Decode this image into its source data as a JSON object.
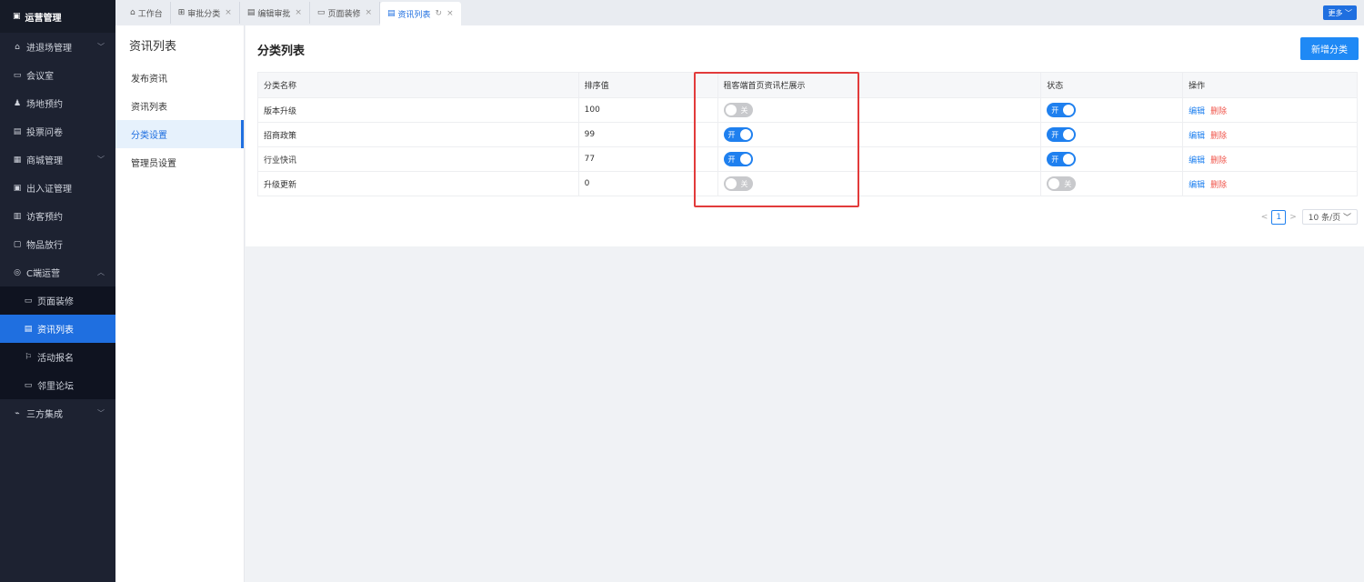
{
  "sidebar": {
    "header": "运营管理",
    "items": [
      {
        "label": "进退场管理",
        "icon": "home-icon",
        "chev": "﹀"
      },
      {
        "label": "会议室",
        "icon": "monitor-icon",
        "chev": ""
      },
      {
        "label": "场地预约",
        "icon": "user-icon",
        "chev": ""
      },
      {
        "label": "投票问卷",
        "icon": "document-icon",
        "chev": ""
      },
      {
        "label": "商城管理",
        "icon": "shop-icon",
        "chev": "﹀"
      },
      {
        "label": "出入证管理",
        "icon": "card-icon",
        "chev": ""
      },
      {
        "label": "访客预约",
        "icon": "visitor-icon",
        "chev": ""
      },
      {
        "label": "物品放行",
        "icon": "box-icon",
        "chev": ""
      },
      {
        "label": "C端运营",
        "icon": "c-icon",
        "chev": "︿"
      }
    ],
    "sub_items": [
      {
        "label": "页面装修",
        "icon": "page-icon"
      },
      {
        "label": "资讯列表",
        "icon": "news-icon"
      },
      {
        "label": "活动报名",
        "icon": "flag-icon"
      },
      {
        "label": "邻里论坛",
        "icon": "chat-icon"
      }
    ],
    "tail": {
      "label": "三方集成",
      "icon": "link-icon",
      "chev": "﹀"
    }
  },
  "tabs": [
    {
      "label": "工作台",
      "icon": "home-icon",
      "closable": false
    },
    {
      "label": "审批分类",
      "icon": "grid-icon",
      "closable": true
    },
    {
      "label": "编辑审批",
      "icon": "edit-icon",
      "closable": true
    },
    {
      "label": "页面装修",
      "icon": "page-icon",
      "closable": true
    },
    {
      "label": "资讯列表",
      "icon": "news-icon",
      "closable": true,
      "active": true
    }
  ],
  "more_label": "更多 ﹀",
  "submenu": {
    "title": "资讯列表",
    "items": [
      "发布资讯",
      "资讯列表",
      "分类设置",
      "管理员设置"
    ],
    "active_index": 2
  },
  "main": {
    "title": "分类列表",
    "add_button": "新增分类",
    "columns": [
      "分类名称",
      "排序值",
      "租客端首页资讯栏展示",
      "状态",
      "操作"
    ],
    "rows": [
      {
        "name": "版本升级",
        "sort": "100",
        "show_home": false,
        "status": true
      },
      {
        "name": "招商政策",
        "sort": "99",
        "show_home": true,
        "status": true
      },
      {
        "name": "行业快讯",
        "sort": "77",
        "show_home": true,
        "status": true
      },
      {
        "name": "升级更新",
        "sort": "0",
        "show_home": false,
        "status": false
      }
    ],
    "switch_on_label": "开",
    "switch_off_label": "关",
    "action_edit": "编辑",
    "action_delete": "删除",
    "pager": {
      "prev": "<",
      "page": "1",
      "next": ">",
      "size": "10 条/页 ﹀"
    }
  },
  "colors": {
    "accent": "#1f80ef",
    "danger": "#f0554b",
    "highlight": "#e23b3b"
  }
}
